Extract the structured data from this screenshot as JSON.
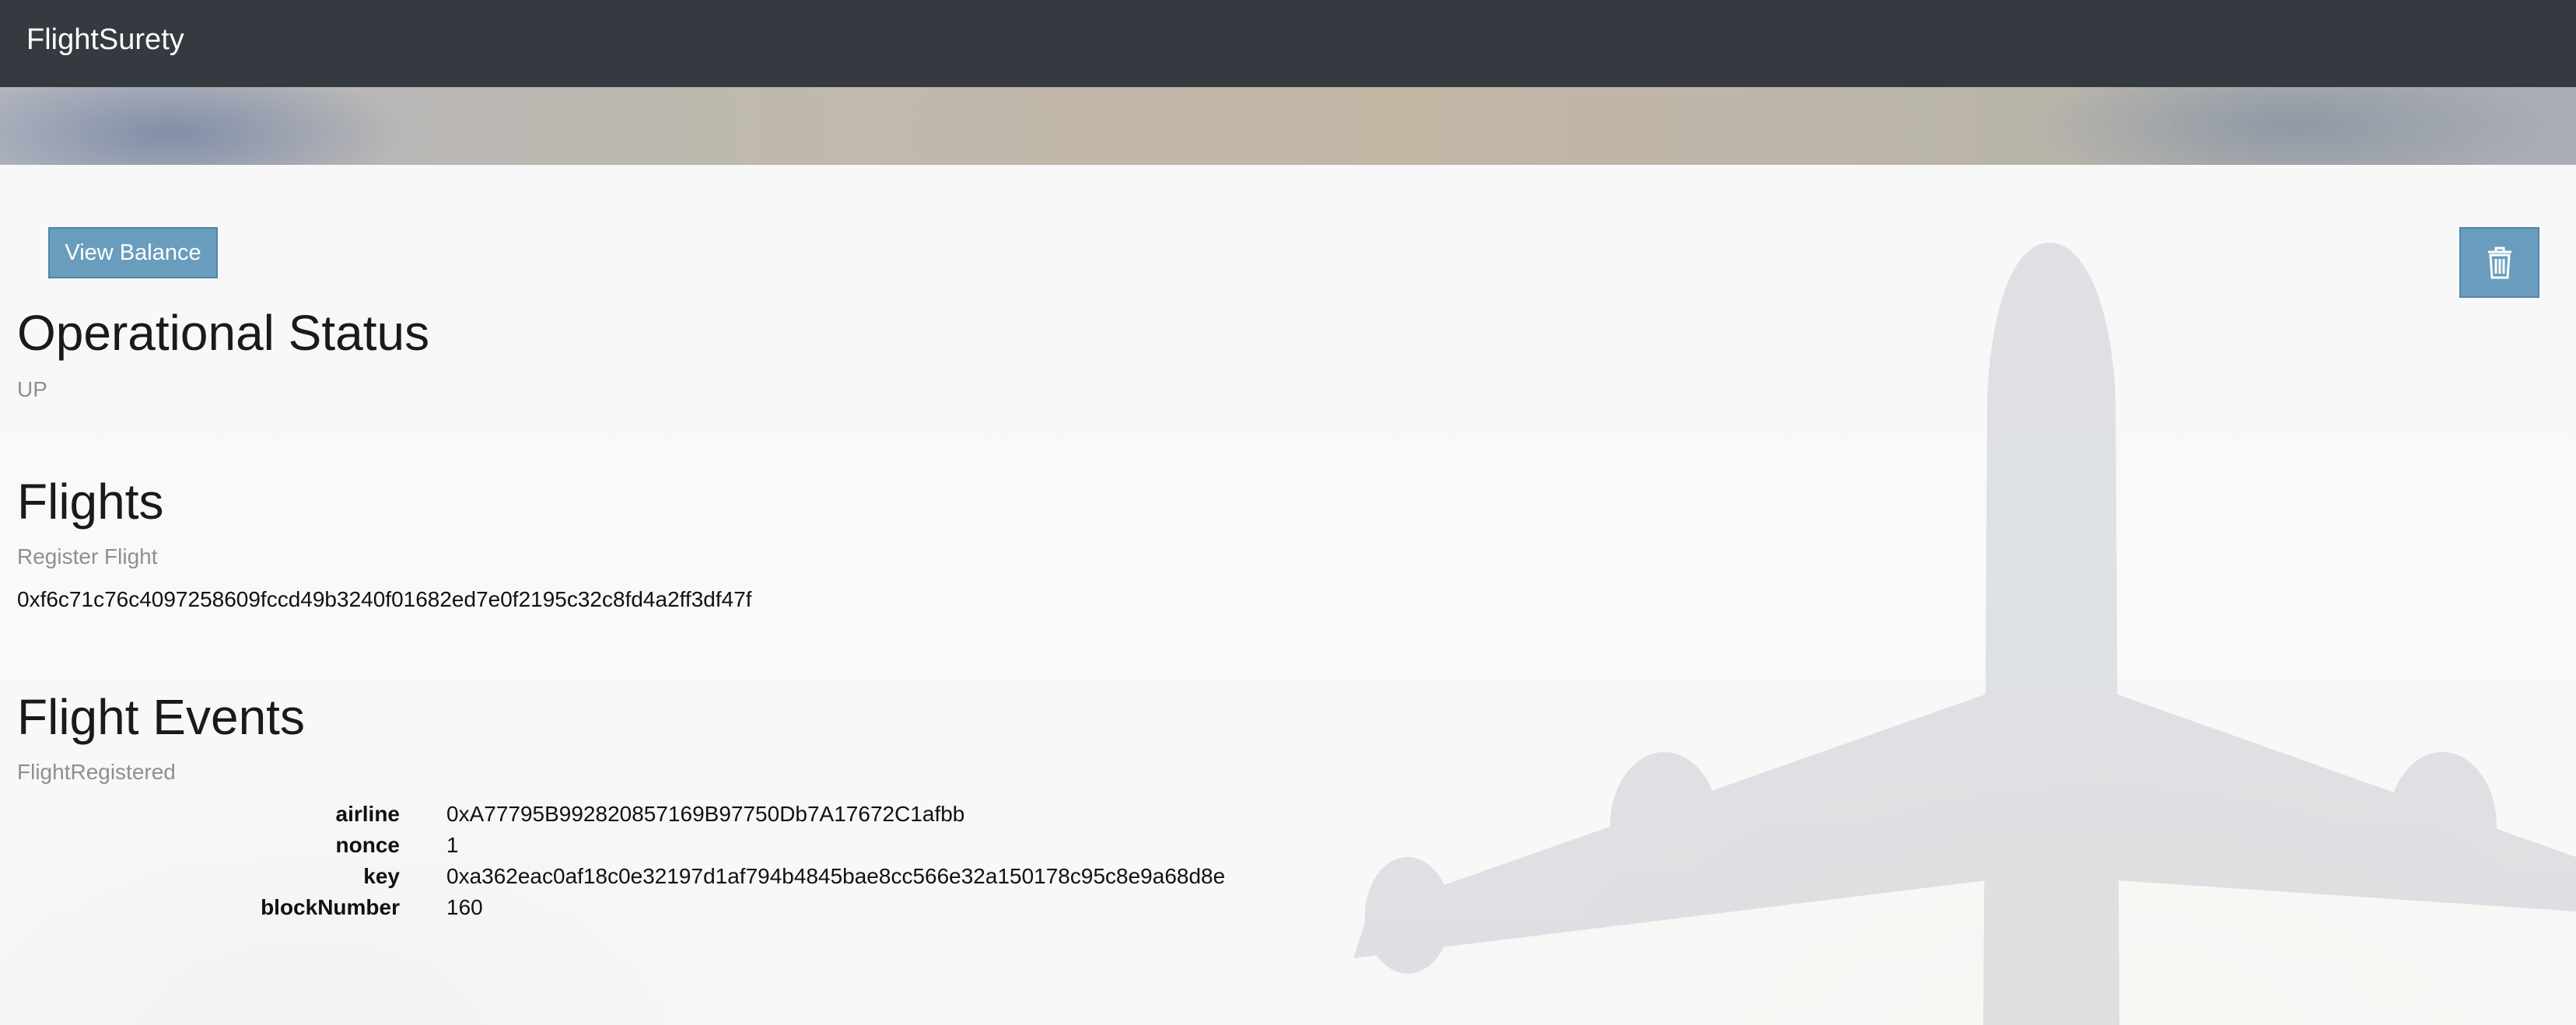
{
  "navbar": {
    "brand": "FlightSurety"
  },
  "toolbar": {
    "view_balance_label": "View Balance",
    "delete_icon": "trash-icon"
  },
  "operational": {
    "title": "Operational Status",
    "status": "UP"
  },
  "flights": {
    "title": "Flights",
    "subtitle": "Register Flight",
    "hash": "0xf6c71c76c4097258609fccd49b3240f01682ed7e0f2195c32c8fd4a2ff3df47f"
  },
  "events": {
    "title": "Flight Events",
    "event_name": "FlightRegistered",
    "rows": [
      {
        "key": "airline",
        "value": "0xA77795B992820857169B97750Db7A17672C1afbb"
      },
      {
        "key": "nonce",
        "value": "1"
      },
      {
        "key": "key",
        "value": "0xa362eac0af18c0e32197d1af794b4845bae8cc566e32a150178c95c8e9a68d8e"
      },
      {
        "key": "blockNumber",
        "value": "160"
      }
    ]
  },
  "colors": {
    "navbar_bg": "#343a40",
    "button_bg": "#6a9dbd",
    "muted_text": "#8f8f8f"
  }
}
